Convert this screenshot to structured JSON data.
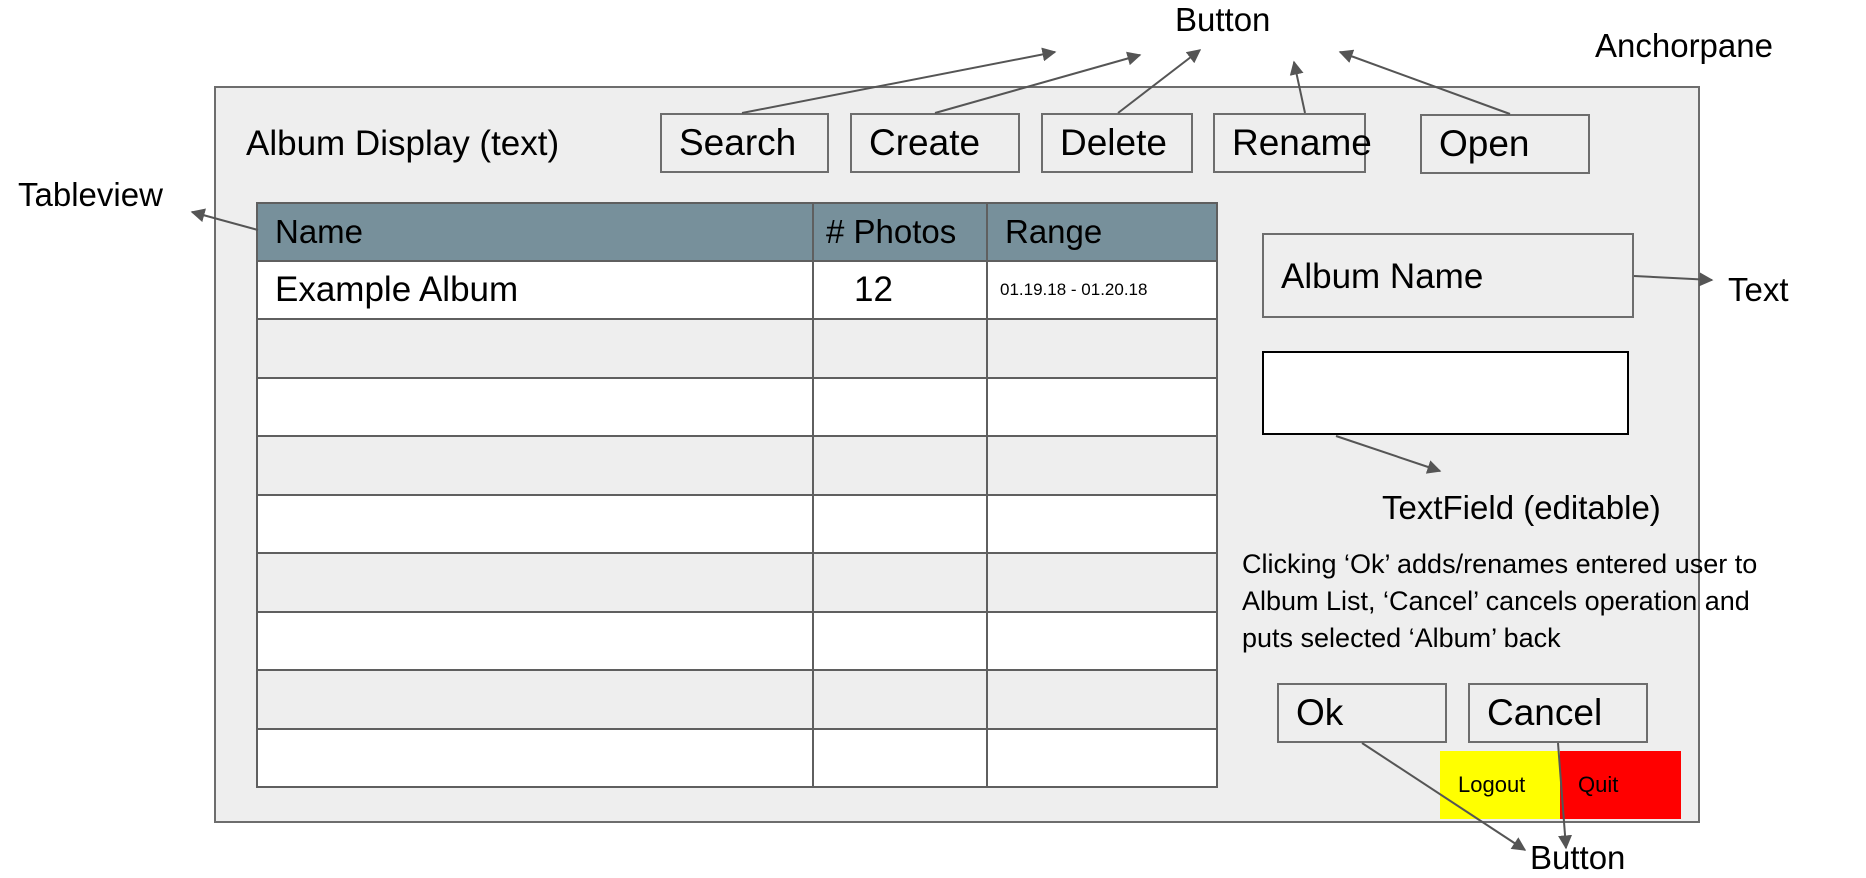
{
  "colors": {
    "anchorpane_bg": "#eeeeee",
    "table_header_bg": "#77909b",
    "logout_bg": "#ffff00",
    "quit_bg": "#ff0000"
  },
  "window": {
    "title": "Album Display (text)",
    "buttons": [
      "Search",
      "Create",
      "Delete",
      "Rename",
      "Open"
    ]
  },
  "table": {
    "columns": [
      "Name",
      "# Photos",
      "Range"
    ],
    "rows": [
      {
        "name": "Example Album",
        "photos": "12",
        "range": "01.19.18 - 01.20.18"
      },
      {
        "name": "",
        "photos": "",
        "range": ""
      },
      {
        "name": "",
        "photos": "",
        "range": ""
      },
      {
        "name": "",
        "photos": "",
        "range": ""
      },
      {
        "name": "",
        "photos": "",
        "range": ""
      },
      {
        "name": "",
        "photos": "",
        "range": ""
      },
      {
        "name": "",
        "photos": "",
        "range": ""
      },
      {
        "name": "",
        "photos": "",
        "range": ""
      },
      {
        "name": "",
        "photos": "",
        "range": ""
      }
    ]
  },
  "side_panel": {
    "album_name_label": "Album Name",
    "album_name_value": "",
    "note_lines": [
      "Clicking ‘Ok’ adds/renames entered user to",
      "Album List, ‘Cancel’ cancels operation and",
      "puts selected ‘Album’ back"
    ],
    "ok_label": "Ok",
    "cancel_label": "Cancel",
    "logout_label": "Logout",
    "quit_label": "Quit"
  },
  "annotations": {
    "button_top": "Button",
    "anchorpane": "Anchorpane",
    "tableview": "Tableview",
    "text": "Text",
    "textfield": "TextField (editable)",
    "button_bottom": "Button"
  }
}
